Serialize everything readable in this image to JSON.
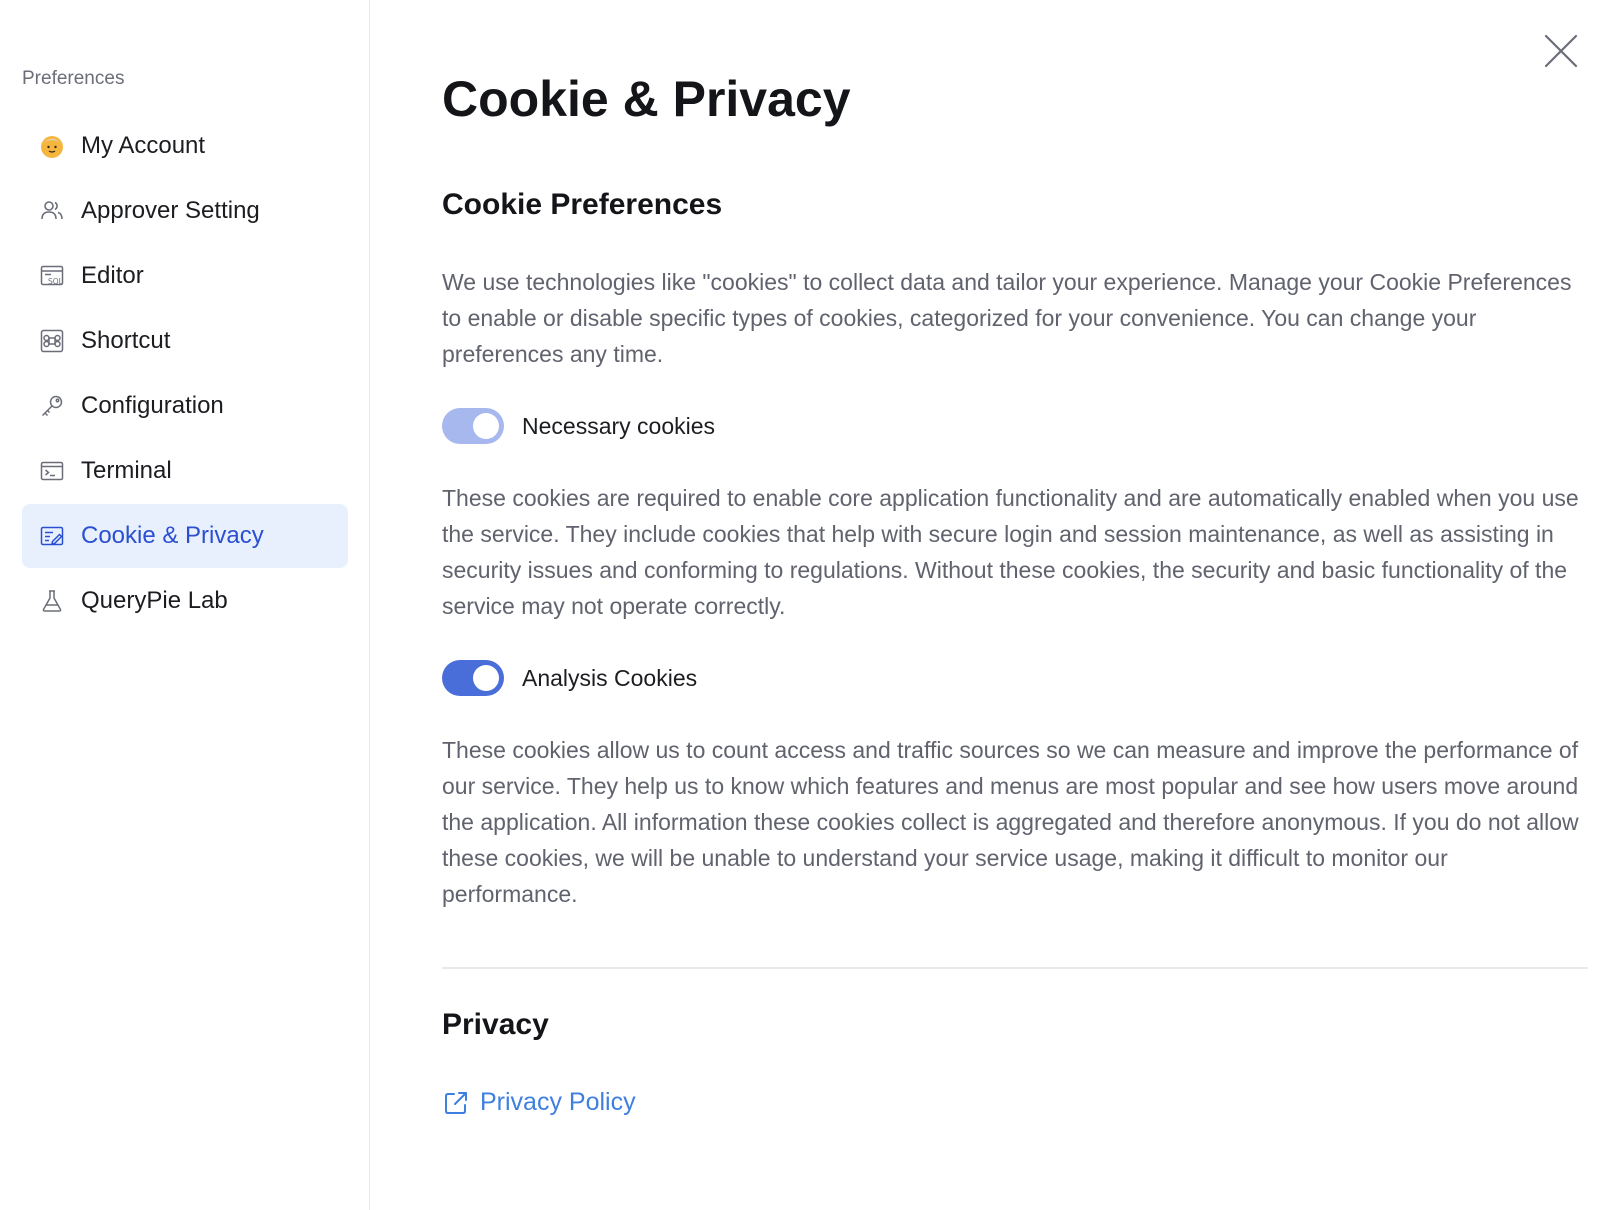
{
  "colors": {
    "accent": "#2a4fd1",
    "link": "#3f7fe0",
    "toggle_disabled_on": "#a6b8ee",
    "toggle_on": "#4a6ed9",
    "active_bg": "#e9f0fd"
  },
  "sidebar": {
    "heading": "Preferences",
    "items": [
      {
        "label": "My Account",
        "icon": "avatar-icon",
        "active": false
      },
      {
        "label": "Approver Setting",
        "icon": "users-icon",
        "active": false
      },
      {
        "label": "Editor",
        "icon": "sql-editor-icon",
        "active": false
      },
      {
        "label": "Shortcut",
        "icon": "command-key-icon",
        "active": false
      },
      {
        "label": "Configuration",
        "icon": "key-icon",
        "active": false
      },
      {
        "label": "Terminal",
        "icon": "terminal-icon",
        "active": false
      },
      {
        "label": "Cookie & Privacy",
        "icon": "cookie-privacy-icon",
        "active": true
      },
      {
        "label": "QueryPie Lab",
        "icon": "flask-icon",
        "active": false
      }
    ]
  },
  "header": {
    "close_icon": "close-icon"
  },
  "main": {
    "title": "Cookie & Privacy",
    "cookie_section": {
      "title": "Cookie Preferences",
      "description": "We use technologies like \"cookies\" to collect data and tailor your experience. Manage your Cookie Preferences to enable or disable specific types of cookies, categorized for your convenience. You can change your preferences any time.",
      "necessary": {
        "label": "Necessary cookies",
        "enabled": true,
        "locked": true,
        "description": "These cookies are required to enable core application functionality and are automatically enabled when you use the service. They include cookies that help with secure login and session maintenance, as well as assisting in security issues and conforming to regulations. Without these cookies, the security and basic functionality of the service may not operate correctly."
      },
      "analysis": {
        "label": "Analysis Cookies",
        "enabled": true,
        "locked": false,
        "description": "These cookies allow us to count access and traffic sources so we can measure and improve the performance of our service. They help us to know which features and menus are most popular and see how users move around the application. All information these cookies collect is aggregated and therefore anonymous. If you do not allow these cookies, we will be unable to understand your service usage, making it difficult to monitor our performance."
      }
    },
    "privacy_section": {
      "title": "Privacy",
      "link_label": "Privacy Policy",
      "link_icon": "external-link-icon"
    }
  }
}
